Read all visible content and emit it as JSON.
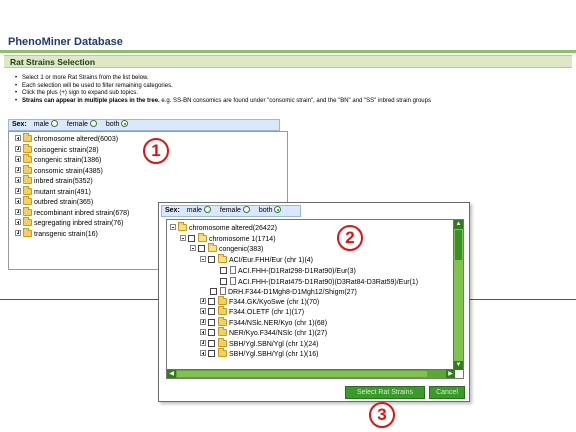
{
  "page": {
    "title": "PhenoMiner Database",
    "section_title": "Rat Strains Selection",
    "instructions": [
      "Select 1 or more Rat Strains from the list below.",
      "Each selection will be used to filter remaining categories.",
      "Click the plus (+) sign to expand sub topics."
    ],
    "instruction_bold": "Strains can appear in multiple places in the tree.",
    "instruction_tail": " e.g. SS-BN consomics are found under \"consomic strain\", and the \"BN\" and \"SS\" inbred strain groups"
  },
  "sex_filter": {
    "label": "Sex:",
    "options": [
      "male",
      "female",
      "both"
    ],
    "selected": "both"
  },
  "tree": {
    "items": [
      "chromosome altered(6003)",
      "coisogenic strain(28)",
      "congenic strain(1386)",
      "consomic strain(4385)",
      "inbred strain(5352)",
      "mutant strain(491)",
      "outbred strain(365)",
      "recombinant inbred strain(678)",
      "segregating inbred strain(76)",
      "transgenic strain(16)"
    ]
  },
  "dialog": {
    "tree": [
      "chromosome altered(26422)",
      "chromosome 1(1714)",
      "congenic(383)",
      "ACI/Eur.FHH/Eur (chr 1)(4)",
      "ACI.FHH-(D1Rat298-D1Rat90)/Eur(3)",
      "ACI.FHH-(D1Rat475-D1Rat90)(D3Rat84-D3Rat59)/Eur(1)",
      "DRH.F344-D1Mgh8-D1Mgh12/Shigm(27)",
      "F344.GK/KyoSwe (chr 1)(70)",
      "F344.OLETF (chr 1)(17)",
      "F344/NSlc.NER/Kyo (chr 1)(68)",
      "NER/Kyo.F344/NSlc (chr 1)(27)",
      "SBH/Ygl.SBN/Ygl (chr 1)(24)",
      "SBH/Ygl.SBH/Ygl (chr 1)(16)"
    ],
    "select_button": "Select Rat Strains",
    "cancel_button": "Cancel"
  },
  "badges": [
    "1",
    "2",
    "3"
  ],
  "colors": {
    "title": "#1f3b73",
    "section_bar": "#dde9c4",
    "sex_bar": "#d9e8ff",
    "scrollbar": "#7fc24f",
    "button": "#3a9a2a",
    "badge": "#e01212"
  },
  "icons": [
    "folder-icon",
    "expand-icon",
    "collapse-icon",
    "checkbox",
    "document-icon",
    "radio-button",
    "scroll-arrow-icon"
  ]
}
